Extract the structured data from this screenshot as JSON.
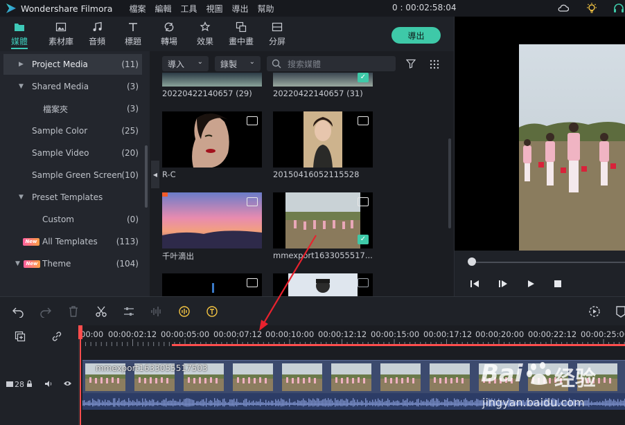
{
  "titlebar": {
    "app_name": "Wondershare Filmora",
    "menus": [
      "檔案",
      "編輯",
      "工具",
      "視圖",
      "導出",
      "幫助"
    ],
    "timecode": "0 : 00:02:58:04",
    "icons": [
      "cloud-icon",
      "bulb-icon",
      "headset-icon"
    ]
  },
  "tabs": [
    {
      "label": "媒體",
      "icon": "folder-icon",
      "active": true
    },
    {
      "label": "素材庫",
      "icon": "image-icon"
    },
    {
      "label": "音頻",
      "icon": "music-icon"
    },
    {
      "label": "標題",
      "icon": "text-icon"
    },
    {
      "label": "轉場",
      "icon": "transition-icon"
    },
    {
      "label": "效果",
      "icon": "effects-icon"
    },
    {
      "label": "畫中畫",
      "icon": "pip-icon"
    },
    {
      "label": "分屏",
      "icon": "splitscreen-icon"
    }
  ],
  "export_label": "導出",
  "sidebar": {
    "items": [
      {
        "label": "Project Media",
        "count": "(11)",
        "selected": true,
        "arrow": "▶"
      },
      {
        "label": "Shared Media",
        "count": "(3)",
        "arrow": "▼"
      },
      {
        "label": "檔案夾",
        "count": "(3)"
      },
      {
        "label": "Sample Color",
        "count": "(25)"
      },
      {
        "label": "Sample Video",
        "count": "(20)"
      },
      {
        "label": "Sample Green Screen",
        "count": "(10)"
      },
      {
        "label": "Preset Templates",
        "count": "",
        "arrow": "▼"
      },
      {
        "label": "Custom",
        "count": "(0)"
      },
      {
        "label": "All Templates",
        "count": "(113)",
        "badge": "New"
      },
      {
        "label": "Theme",
        "count": "(104)",
        "badge": "New",
        "arrow": "▼"
      }
    ]
  },
  "media": {
    "import_label": "導入",
    "record_label": "錄製",
    "search_placeholder": "搜索媒體",
    "items": [
      {
        "label": "20220422140657 (29)",
        "type": "video"
      },
      {
        "label": "20220422140657 (31)",
        "type": "video",
        "checked": true
      },
      {
        "label": "R-C",
        "type": "image"
      },
      {
        "label": "20150416052115528",
        "type": "image"
      },
      {
        "label": "千叶滴出",
        "type": "video"
      },
      {
        "label": "mmexport1633055517...",
        "type": "video",
        "checked": true
      },
      {
        "label": "",
        "type": "image"
      },
      {
        "label": "",
        "type": "image"
      }
    ]
  },
  "ruler": {
    "labels": [
      "00:00",
      "00:00:02:12",
      "00:00:05:00",
      "00:00:07:12",
      "00:00:10:00",
      "00:00:12:12",
      "00:00:15:00",
      "00:00:17:12",
      "00:00:20:00",
      "00:00:22:12",
      "00:00:25:00"
    ]
  },
  "timeline": {
    "clip_name": "mmexport1633055517503",
    "track_number": "28"
  },
  "watermark": {
    "brand": "Bai",
    "brand_cn": "经验",
    "url": "jingyan.baidu.com"
  },
  "colors": {
    "accent": "#3ec9a8",
    "playhead": "#ff4d4d",
    "clip": "#3c4a6e"
  }
}
